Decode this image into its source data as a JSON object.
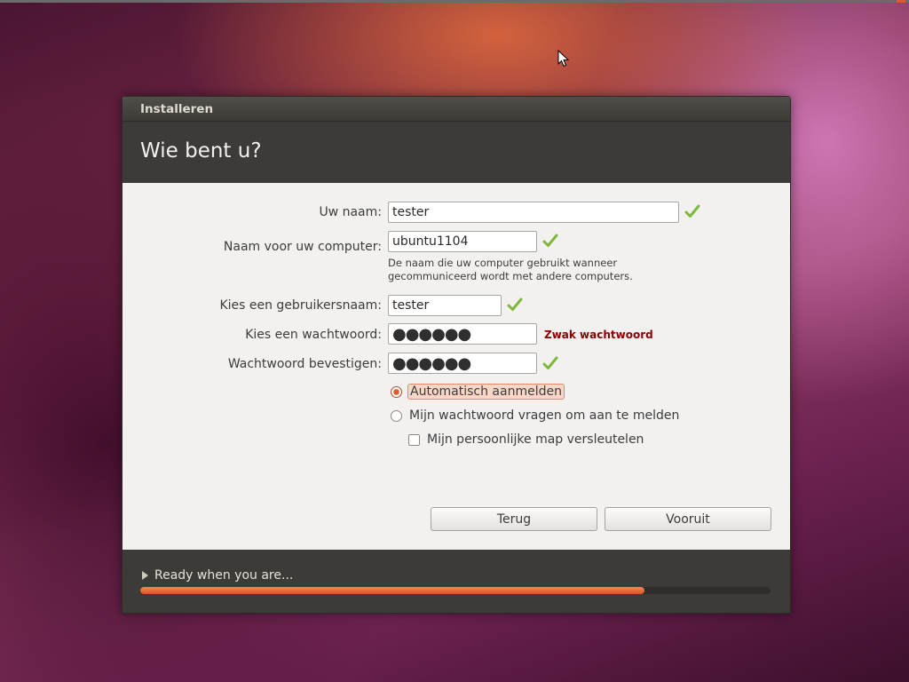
{
  "window": {
    "title": "Installeren",
    "heading": "Wie bent u?"
  },
  "form": {
    "name_label": "Uw naam:",
    "name_value": "tester",
    "computer_label": "Naam voor uw computer:",
    "computer_value": "ubuntu1104",
    "computer_hint_line1": "De naam die uw computer gebruikt wanneer",
    "computer_hint_line2": "gecommuniceerd wordt met andere computers.",
    "username_label": "Kies een gebruikersnaam:",
    "username_value": "tester",
    "password_label": "Kies een wachtwoord:",
    "password_value": "●●●●●●",
    "password_strength": "Zwak wachtwoord",
    "confirm_label": "Wachtwoord bevestigen:",
    "confirm_value": "●●●●●●"
  },
  "login_options": {
    "auto_login": "Automatisch aanmelden",
    "auto_login_selected": true,
    "require_password": "Mijn wachtwoord vragen om aan te melden",
    "encrypt_home": "Mijn persoonlijke map versleutelen",
    "encrypt_home_checked": false
  },
  "buttons": {
    "back": "Terug",
    "forward": "Vooruit"
  },
  "footer": {
    "status": "Ready when you are...",
    "progress_percent": 80
  },
  "colors": {
    "accent": "#e05a2b",
    "check_green": "#7fb83a",
    "weak_password": "#8b0000"
  },
  "icons": {
    "valid": "checkmark-icon",
    "expander": "triangle-right-icon",
    "pointer": "mouse-cursor-icon"
  }
}
